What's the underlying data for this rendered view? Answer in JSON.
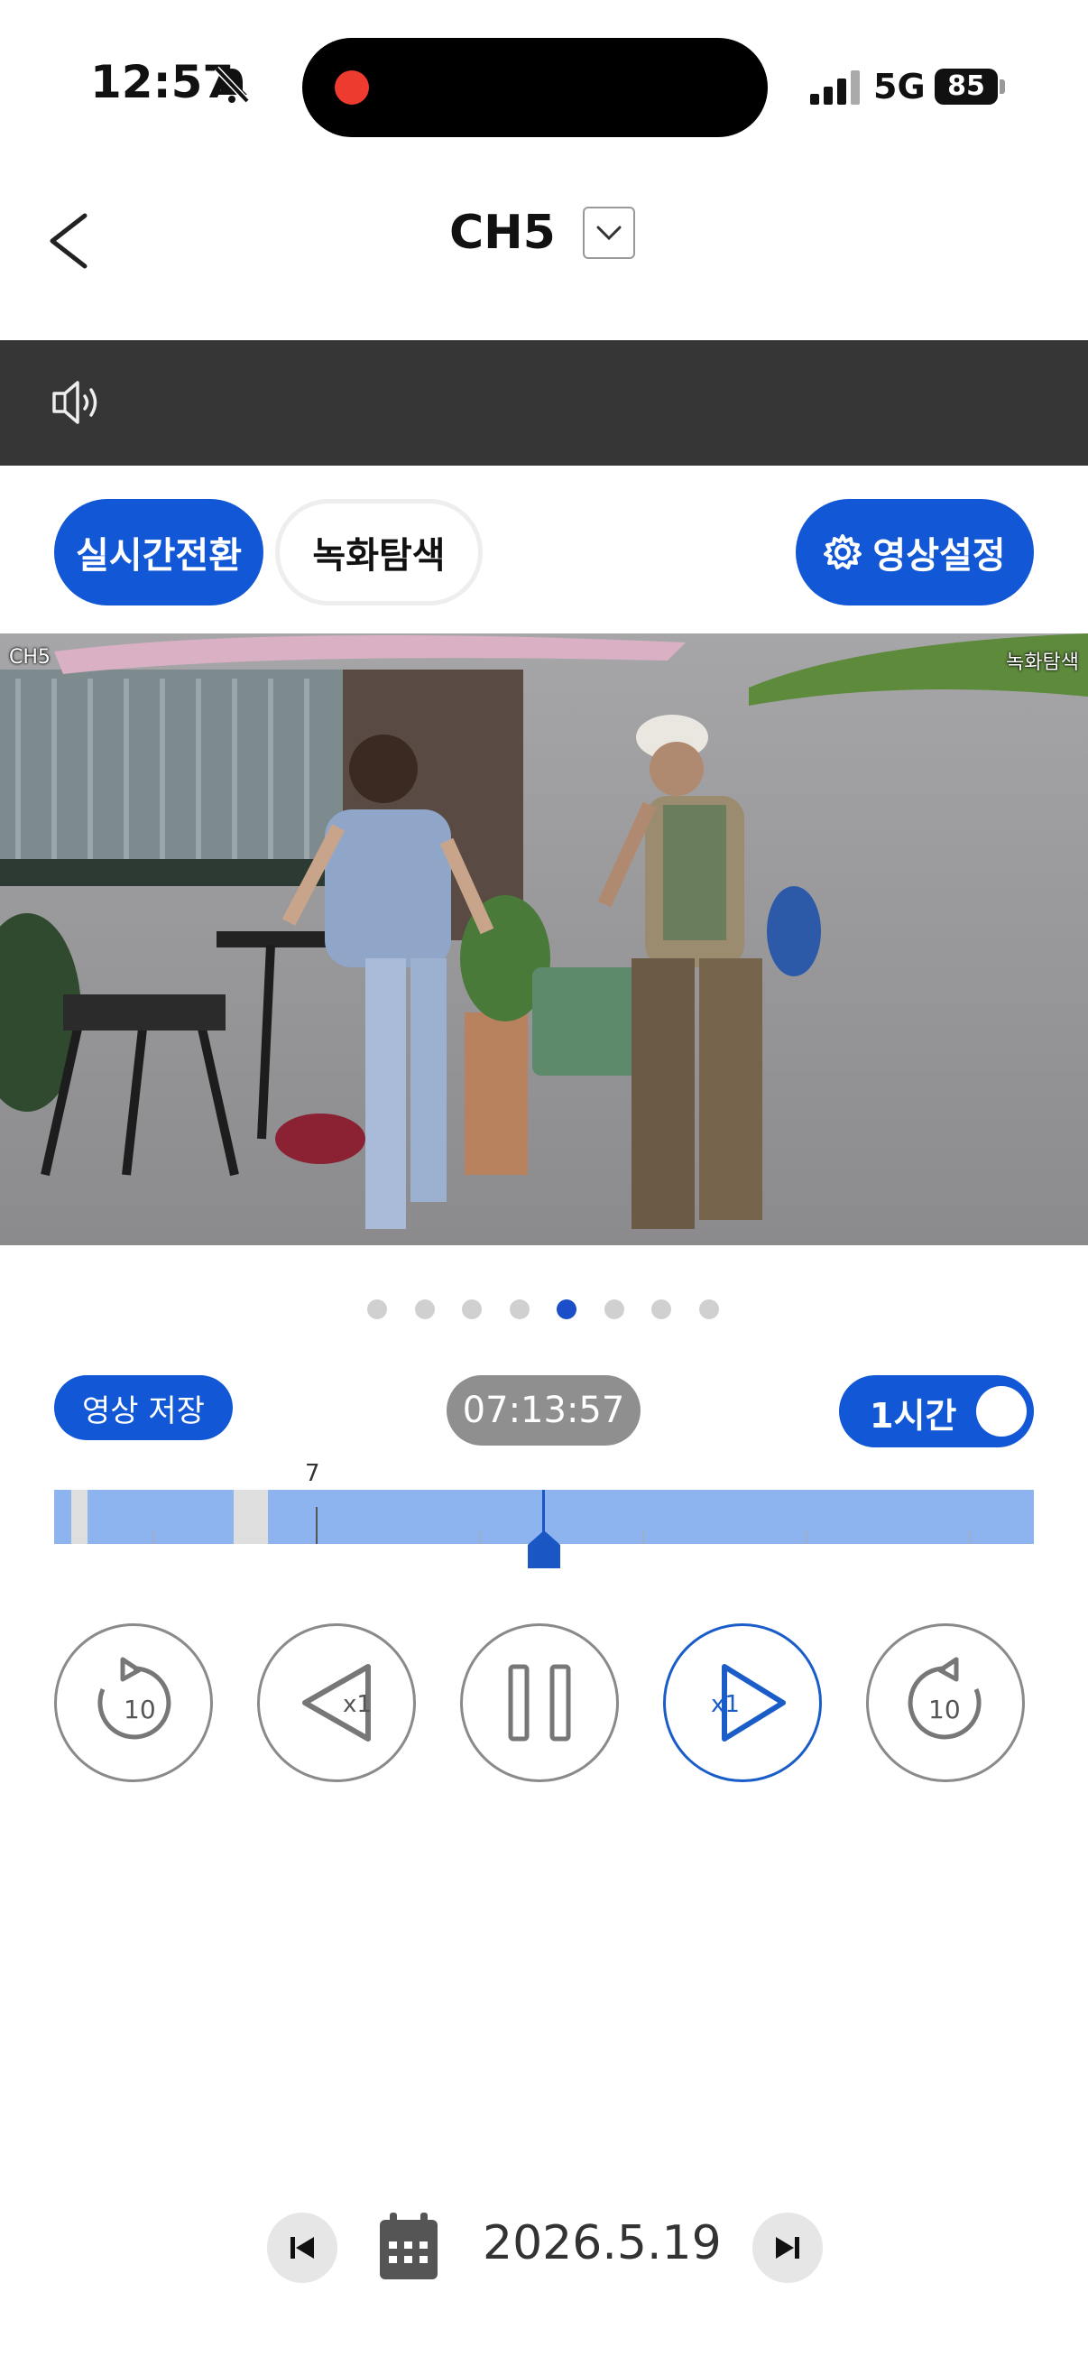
{
  "status_bar": {
    "time": "12:57",
    "network": "5G",
    "battery": "85"
  },
  "header": {
    "title": "CH5"
  },
  "modes": {
    "live_label": "실시간전환",
    "search_label": "녹화탐색",
    "settings_label": "영상설정"
  },
  "video": {
    "channel_overlay": "CH5",
    "mode_overlay": "녹화탐색"
  },
  "pager": {
    "count": 8,
    "active_index": 4
  },
  "playback": {
    "save_label": "영상 저장",
    "current_time": "07:13:57",
    "range_label": "1시간",
    "range_toggle_on": true
  },
  "timeline": {
    "hour_label": "7"
  },
  "controls": {
    "rewind_seconds": "10",
    "reverse_speed": "x1",
    "forward_speed": "x1",
    "forward_seconds": "10"
  },
  "date_nav": {
    "date": "2026.5.19"
  },
  "colors": {
    "accent": "#1257d6",
    "dark_bar": "#363636",
    "timeline_fill": "#8db4ee"
  }
}
